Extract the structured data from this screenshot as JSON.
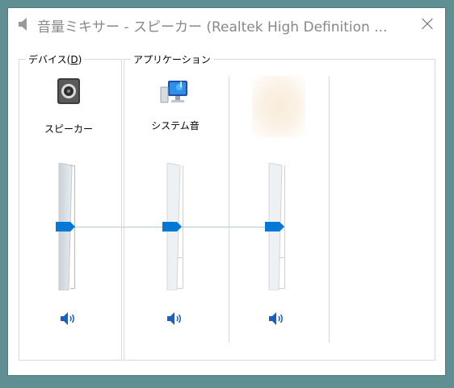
{
  "window": {
    "title": "音量ミキサー - スピーカー (Realtek High Definition ..."
  },
  "groups": {
    "device_label": "デバイス(D)",
    "device_label_prefix": "デバイス(",
    "device_label_accel": "D",
    "device_label_suffix": ")",
    "app_label": "アプリケーション"
  },
  "channels": [
    {
      "name": "スピーカー",
      "icon": "speaker-device-icon",
      "level": 0.5,
      "muted": false
    },
    {
      "name": "システム音",
      "icon": "system-sounds-icon",
      "level": 0.5,
      "muted": false
    },
    {
      "name": "",
      "icon": "blurred-app-icon",
      "level": 0.5,
      "muted": false
    }
  ],
  "colors": {
    "accent": "#0078d7",
    "background": "#5f8f92",
    "window": "#ffffff"
  }
}
